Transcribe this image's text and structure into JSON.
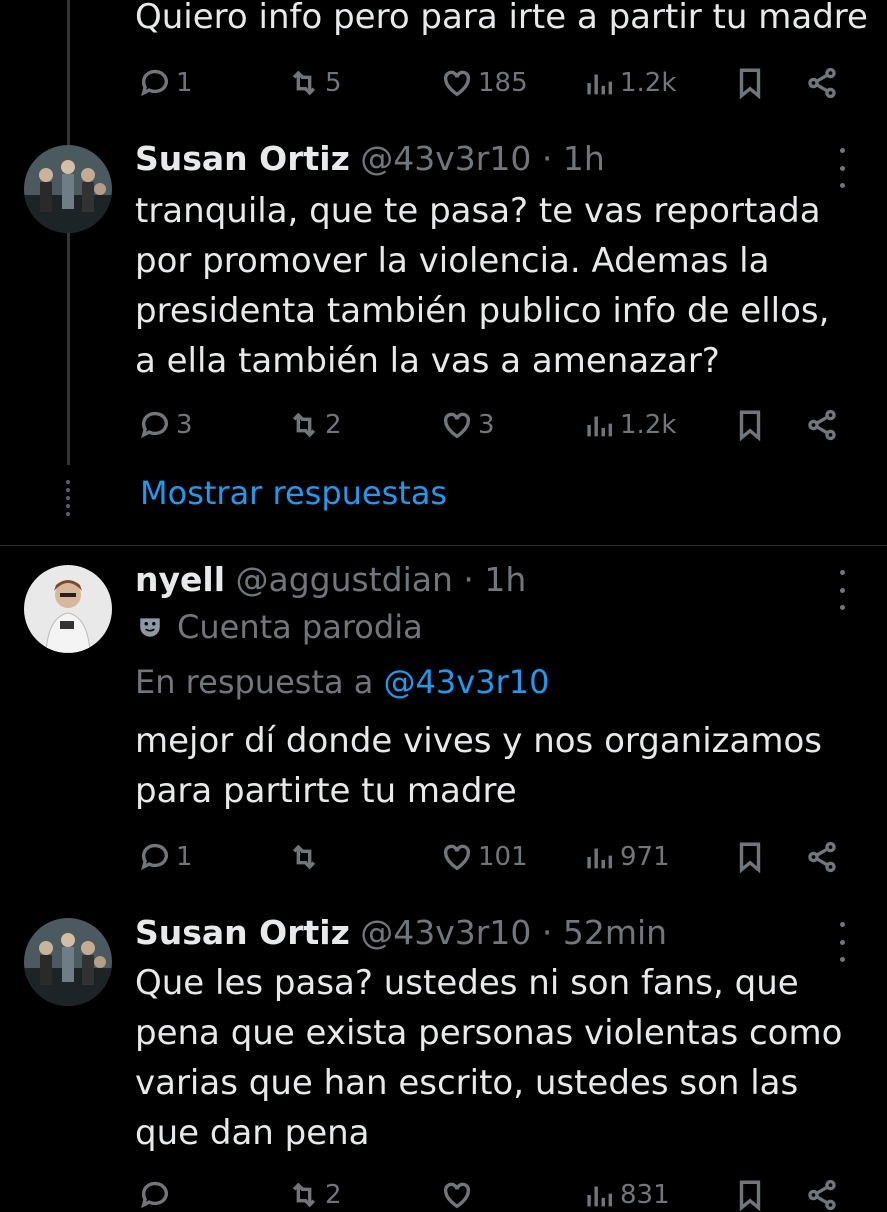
{
  "tweets": [
    {
      "text_lines": [
        "Quiero info pero para irte a partir tu madre"
      ],
      "stats": {
        "replies": "1",
        "reposts": "5",
        "likes": "185",
        "views": "1.2k"
      }
    },
    {
      "name": "Susan Ortiz",
      "handle": "@43v3r10 · 1h",
      "text_lines": [
        "tranquila, que te pasa? te vas reportada",
        "por promover la violencia. Ademas la",
        "presidenta también publico info de ellos,",
        "a ella también la vas a amenazar?"
      ],
      "stats": {
        "replies": "3",
        "reposts": "2",
        "likes": "3",
        "views": "1.2k"
      },
      "show_replies": "Mostrar respuestas"
    },
    {
      "name": "nyell",
      "handle": "@aggustdian · 1h",
      "badge_label": "Cuenta parodia",
      "reply_prefix": "En respuesta a ",
      "reply_to": "@43v3r10",
      "text_lines": [
        "mejor dí donde vives y nos organizamos",
        "para partirte tu madre"
      ],
      "stats": {
        "replies": "1",
        "reposts": "",
        "likes": "101",
        "views": "971"
      }
    },
    {
      "name": "Susan Ortiz",
      "handle": "@43v3r10 · 52min",
      "text_lines": [
        "Que les pasa? ustedes ni son fans, que",
        "pena que exista personas violentas como",
        "varias que han escrito, ustedes son las",
        "que dan pena"
      ],
      "stats": {
        "replies": "",
        "reposts": "2",
        "likes": "",
        "views": "831"
      }
    }
  ],
  "colors": {
    "background": "#000000",
    "text": "#e7e9ea",
    "muted": "#71767b",
    "link": "#1d9bf0"
  },
  "icons": [
    "reply-icon",
    "repost-icon",
    "like-icon",
    "views-icon",
    "bookmark-icon",
    "share-icon",
    "more-icon",
    "parody-mask-icon"
  ]
}
